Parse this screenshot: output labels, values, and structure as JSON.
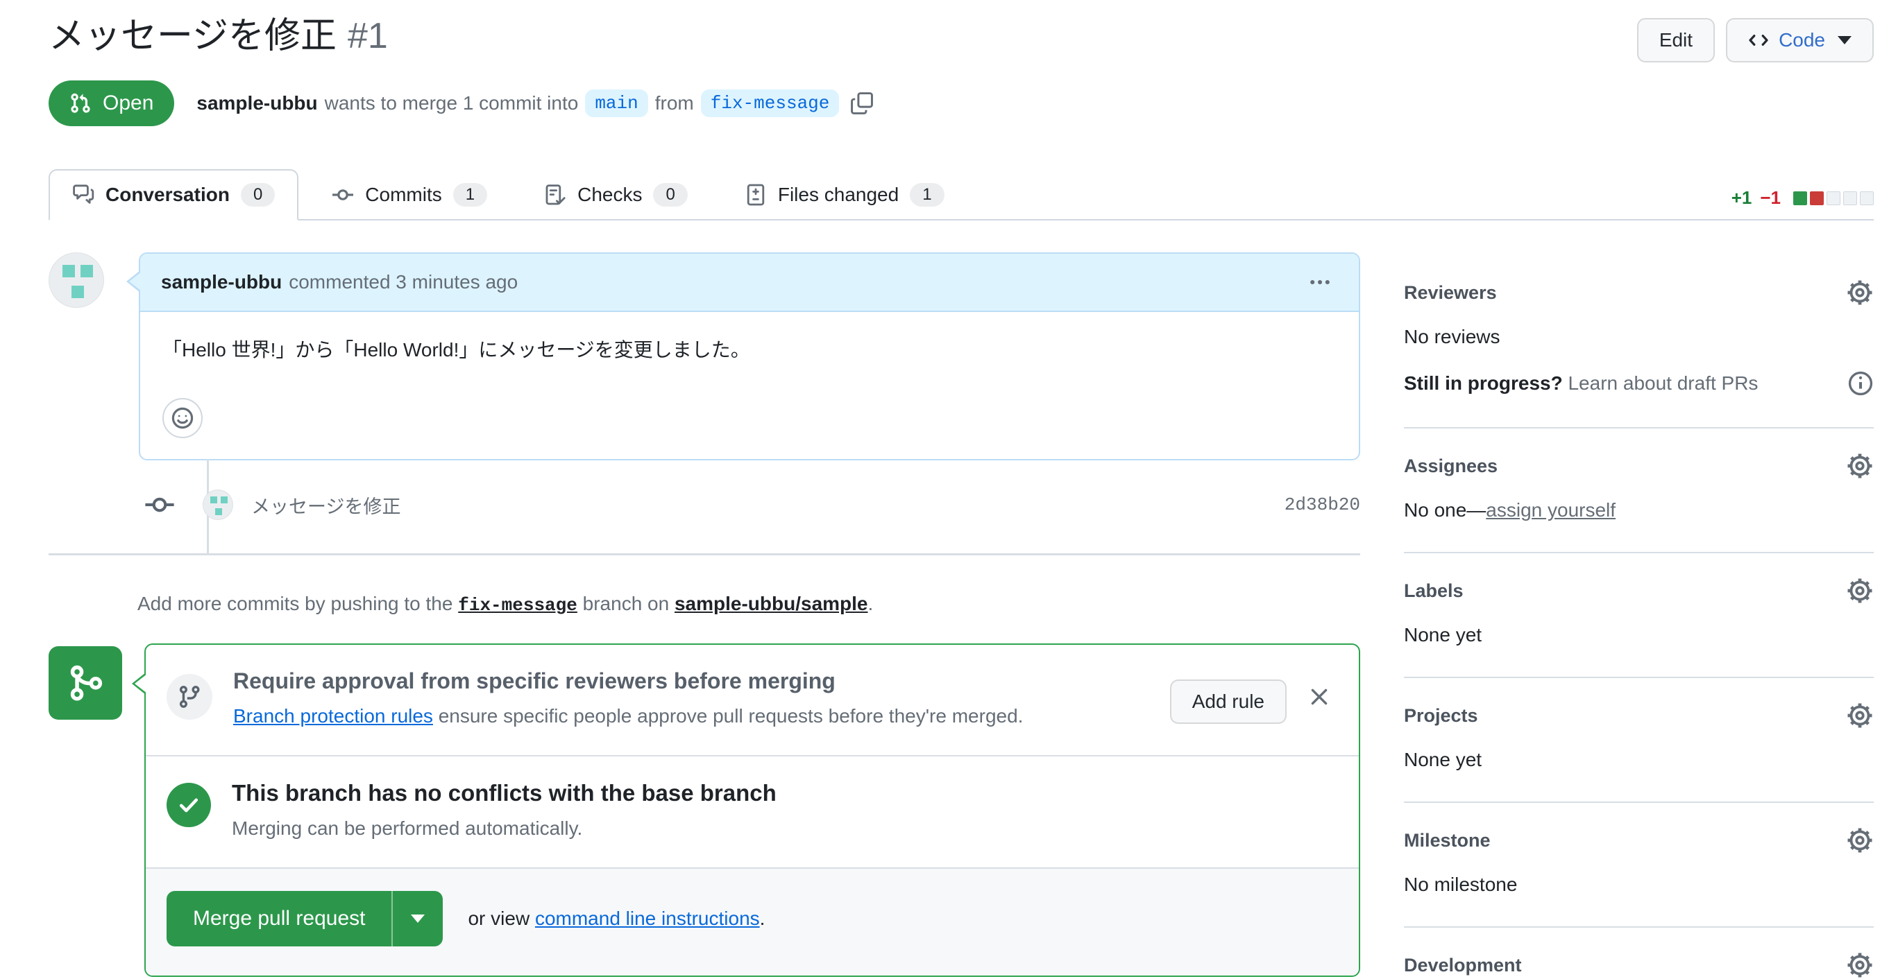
{
  "pr": {
    "title": "メッセージを修正",
    "number": "#1",
    "state": "Open",
    "summary": {
      "author": "sample-ubbu",
      "middle": "wants to merge 1 commit into",
      "base_branch": "main",
      "from_word": "from",
      "head_branch": "fix-message"
    }
  },
  "header_actions": {
    "edit": "Edit",
    "code": "Code"
  },
  "tabs": [
    {
      "label": "Conversation",
      "count": "0"
    },
    {
      "label": "Commits",
      "count": "1"
    },
    {
      "label": "Checks",
      "count": "0"
    },
    {
      "label": "Files changed",
      "count": "1"
    }
  ],
  "diffstat": {
    "additions": "+1",
    "deletions": "−1"
  },
  "comment": {
    "author": "sample-ubbu",
    "meta": "commented 3 minutes ago",
    "body": "「Hello 世界!」から「Hello World!」にメッセージを変更しました。"
  },
  "commit": {
    "message": "メッセージを修正",
    "sha": "2d38b20"
  },
  "push_hint": {
    "prefix": "Add more commits by pushing to the",
    "branch": "fix-message",
    "middle": "branch on",
    "repo": "sample-ubbu/sample",
    "suffix": "."
  },
  "protection_rule": {
    "heading": "Require approval from specific reviewers before merging",
    "link_text": "Branch protection rules",
    "description": "ensure specific people approve pull requests before they're merged.",
    "add_rule_button": "Add rule"
  },
  "merge_status": {
    "heading": "This branch has no conflicts with the base branch",
    "subheading": "Merging can be performed automatically."
  },
  "merge_bar": {
    "merge_button": "Merge pull request",
    "or_view": "or view",
    "cli_link": "command line instructions",
    "suffix": "."
  },
  "sidebar": {
    "reviewers": {
      "heading": "Reviewers",
      "empty": "No reviews",
      "draft_bold": "Still in progress?",
      "draft_link": "Learn about draft PRs"
    },
    "assignees": {
      "heading": "Assignees",
      "empty": "No one—",
      "assign_link": "assign yourself"
    },
    "labels": {
      "heading": "Labels",
      "empty": "None yet"
    },
    "projects": {
      "heading": "Projects",
      "empty": "None yet"
    },
    "milestone": {
      "heading": "Milestone",
      "empty": "No milestone"
    },
    "development": {
      "heading": "Development"
    }
  },
  "colors": {
    "green": "#2c974b",
    "addition_green": "#1a7f37",
    "deletion_red": "#cf222e",
    "link_blue": "#0969da",
    "branch_label_bg": "#ddf4ff",
    "identicon_teal": "#70d1c3"
  }
}
